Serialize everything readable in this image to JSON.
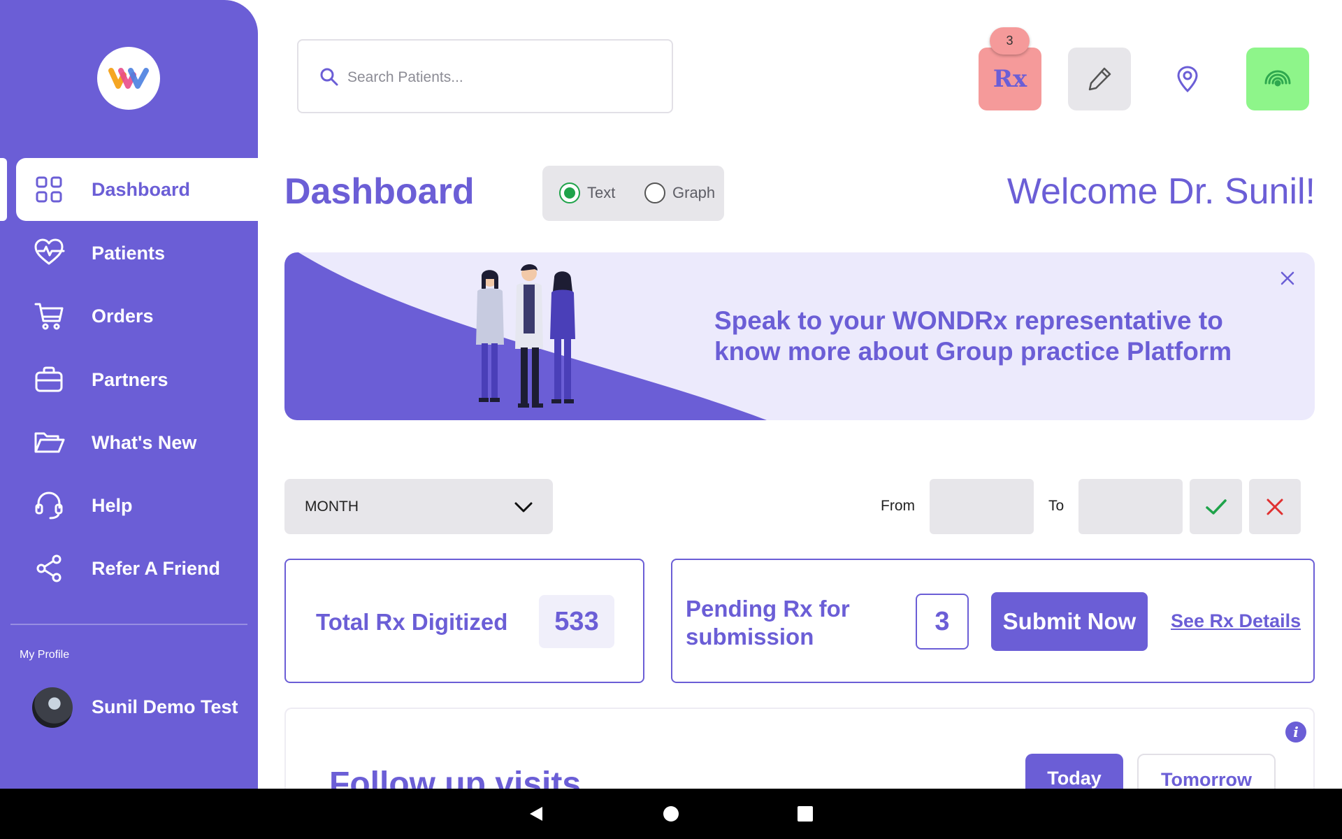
{
  "app": {
    "brand_colors": {
      "primary": "#6b5ed6",
      "rx_badge": "#f59a9a",
      "signal": "#8ef58a",
      "confirm": "#1fa34a",
      "cancel": "#e03030"
    }
  },
  "sidebar": {
    "logo_icon": "wondrx-logo-icon",
    "items": [
      {
        "label": "Dashboard",
        "icon": "grid-icon",
        "active": true
      },
      {
        "label": "Patients",
        "icon": "heart-pulse-icon",
        "active": false
      },
      {
        "label": "Orders",
        "icon": "cart-icon",
        "active": false
      },
      {
        "label": "Partners",
        "icon": "briefcase-icon",
        "active": false
      },
      {
        "label": "What's New",
        "icon": "folder-open-icon",
        "active": false
      },
      {
        "label": "Help",
        "icon": "headset-icon",
        "active": false
      },
      {
        "label": "Refer A Friend",
        "icon": "share-icon",
        "active": false
      }
    ],
    "profile": {
      "caption": "My Profile",
      "name": "Sunil Demo Test"
    }
  },
  "topbar": {
    "search_placeholder": "Search Patients...",
    "rx_badge_count": "3",
    "rx_label": "Rx",
    "icons": [
      "rx-icon",
      "pen-icon",
      "location-pin-icon",
      "signal-icon"
    ]
  },
  "header": {
    "title": "Dashboard",
    "view_options": [
      {
        "label": "Text",
        "selected": true
      },
      {
        "label": "Graph",
        "selected": false
      }
    ],
    "welcome": "Welcome Dr. Sunil!"
  },
  "banner": {
    "text": "Speak to your WONDRx representative to know more about Group practice Platform"
  },
  "filters": {
    "period": "MONTH",
    "from_label": "From",
    "to_label": "To",
    "from_value": "",
    "to_value": ""
  },
  "stats": {
    "total_label": "Total Rx Digitized",
    "total_value": "533",
    "pending_label": "Pending Rx for submission",
    "pending_value": "3",
    "submit_label": "Submit Now",
    "details_link": "See Rx Details"
  },
  "followup": {
    "title": "Follow up visits",
    "tabs": [
      "Today",
      "Tomorrow"
    ]
  }
}
